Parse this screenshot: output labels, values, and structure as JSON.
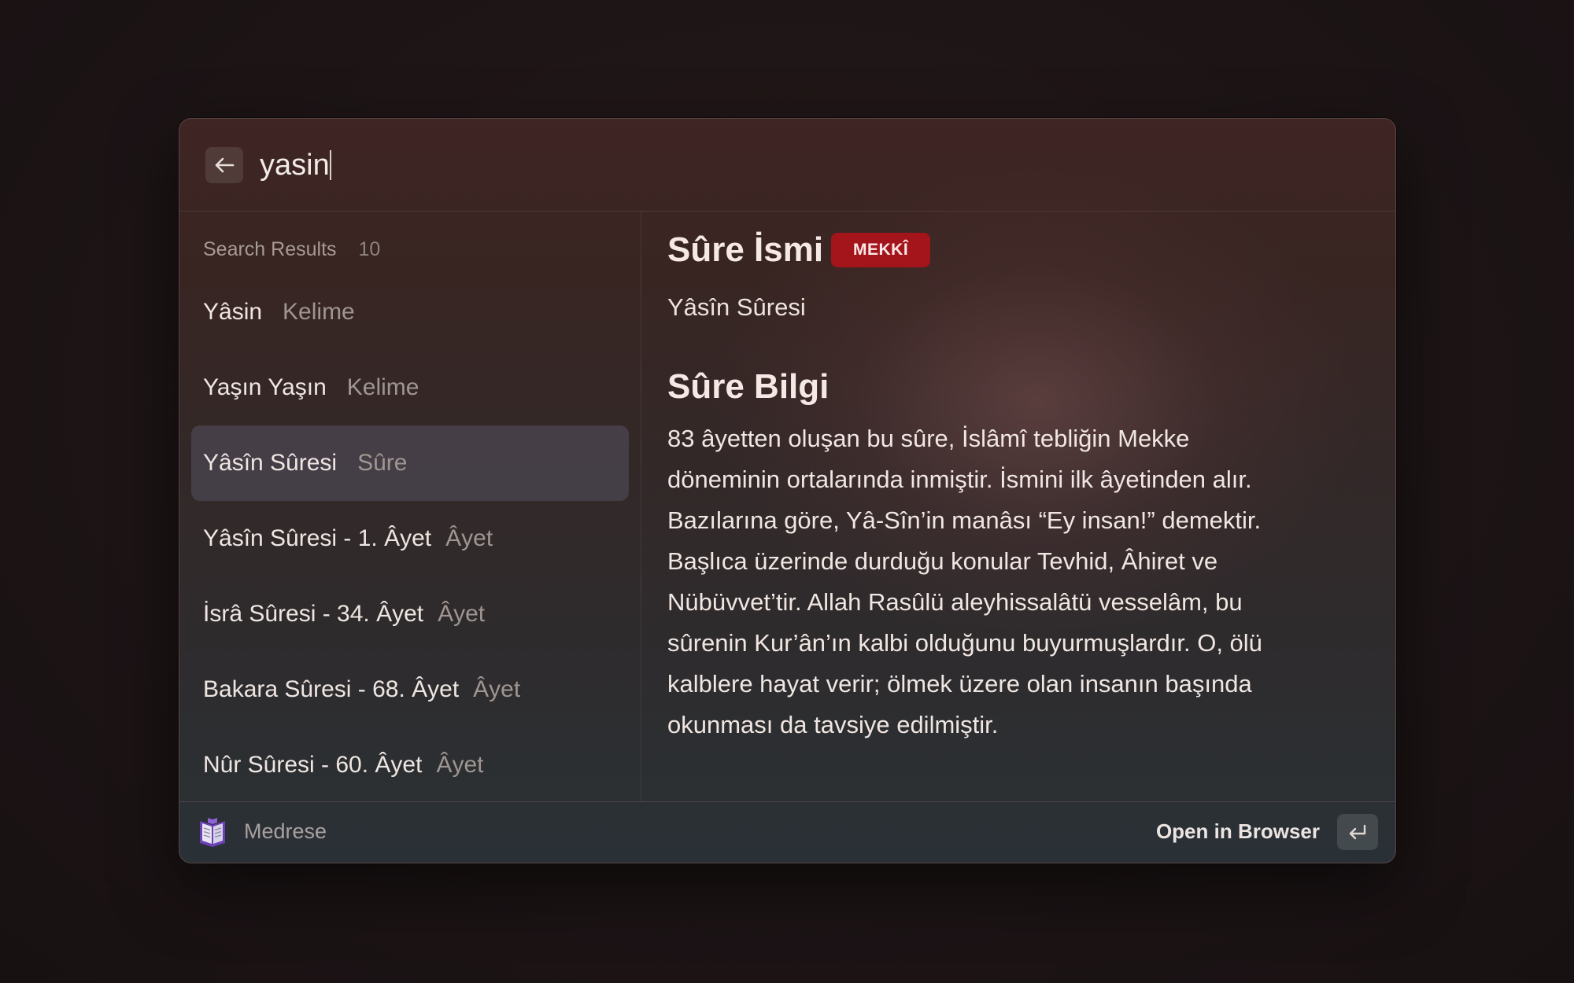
{
  "search": {
    "value": "yasin",
    "back_icon": "arrow-left-icon"
  },
  "results": {
    "header": "Search Results",
    "count": "10",
    "items": [
      {
        "title": "Yâsin",
        "kind": "Kelime"
      },
      {
        "title": "Yaşın Yaşın",
        "kind": "Kelime"
      },
      {
        "title": "Yâsîn Sûresi",
        "kind": "Sûre",
        "selected": true
      },
      {
        "title": "Yâsîn Sûresi - 1. Âyet",
        "kind": "Âyet"
      },
      {
        "title": "İsrâ Sûresi - 34. Âyet",
        "kind": "Âyet"
      },
      {
        "title": "Bakara Sûresi - 68. Âyet",
        "kind": "Âyet"
      },
      {
        "title": "Nûr Sûresi - 60. Âyet",
        "kind": "Âyet"
      }
    ]
  },
  "detail": {
    "title": "Sûre İsmi",
    "badge": "MEKKÎ",
    "badge_color": "#a3141b",
    "subtitle": "Yâsîn Sûresi",
    "section_title": "Sûre Bilgi",
    "section_lines": [
      "83 âyetten oluşan bu sûre, İslâmî tebliğin Mekke",
      "döneminin ortalarında inmiştir. İsmini ilk âyetinden alır.",
      "Bazılarına göre, Yâ-Sîn’in manâsı “Ey insan!” demektir.",
      "Başlıca üzerinde durduğu konular Tevhid, Âhiret ve",
      "Nübüvvet’tir. Allah Rasûlü aleyhissalâtü vesselâm, bu",
      "sûrenin Kur’ân’ın kalbi olduğunu buyurmuşlardır. O, ölü",
      "kalblere hayat verir; ölmek üzere olan insanın başında",
      "okunması da tavsiye edilmiştir."
    ]
  },
  "footer": {
    "app_name": "Medrese",
    "app_icon": "book-icon",
    "action_label": "Open in Browser",
    "enter_icon": "return-key-icon"
  }
}
